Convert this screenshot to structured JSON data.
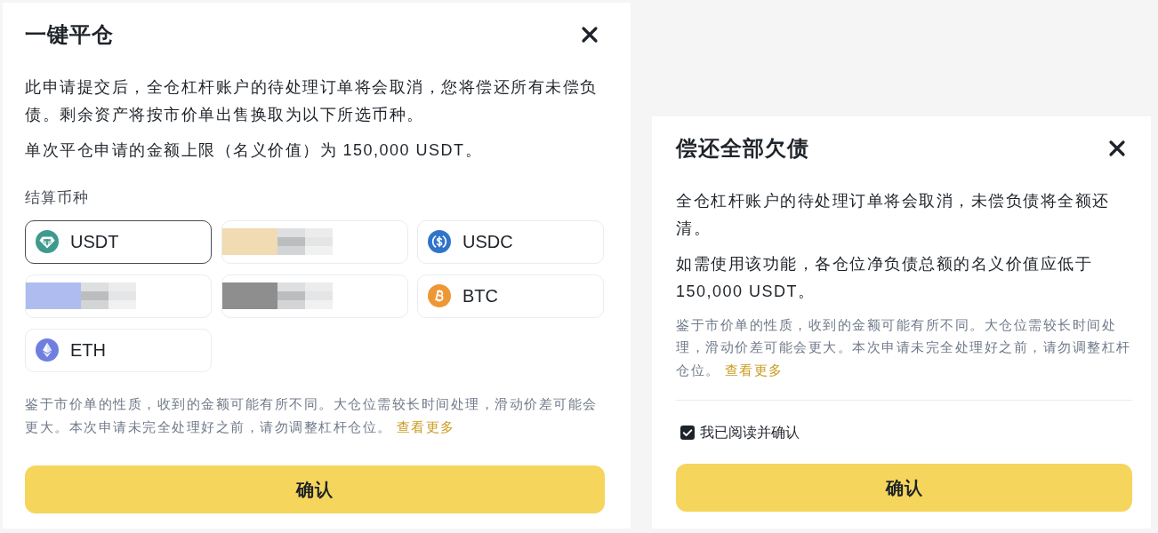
{
  "close_all_dialog": {
    "title": "一键平仓",
    "paragraphs": [
      "此申请提交后，全仓杠杆账户的待处理订单将会取消，您将偿还所有未偿负债。剩余资产将按市价单出售换取为以下所选币种。",
      "单次平仓申请的金额上限（名义价值）为 150,000 USDT。"
    ],
    "settlement": {
      "label": "结算币种",
      "options": [
        {
          "kind": "usdt",
          "label": "USDT",
          "selected": true
        },
        {
          "kind": "redacted",
          "selected": false,
          "color": "#f0dbb2"
        },
        {
          "kind": "usdc",
          "label": "USDC",
          "selected": false
        },
        {
          "kind": "redacted",
          "selected": false,
          "color": "#aebcef"
        },
        {
          "kind": "redacted",
          "selected": false,
          "color": "#8e8e8e"
        },
        {
          "kind": "btc",
          "label": "BTC",
          "selected": false
        },
        {
          "kind": "eth",
          "label": "ETH",
          "selected": false
        }
      ]
    },
    "notice": {
      "text": "鉴于市价单的性质，收到的金额可能有所不同。大仓位需较长时间处理，滑动价差可能会更大。本次申请未完全处理好之前，请勿调整杠杆仓位。",
      "link": "查看更多"
    },
    "confirm_button": "确认"
  },
  "repay_all_dialog": {
    "title": "偿还全部欠债",
    "paragraphs": [
      "全仓杠杆账户的待处理订单将会取消，未偿负债将全额还清。",
      "如需使用该功能，各仓位净负债总额的名义价值应低于 150,000 USDT。"
    ],
    "notice": {
      "text": "鉴于市价单的性质，收到的金额可能有所不同。大仓位需较长时间处理，滑动价差可能会更大。本次申请未完全处理好之前，请勿调整杠杆仓位。",
      "link": "查看更多"
    },
    "acknowledge": {
      "label": "我已阅读并确认",
      "checked": true
    },
    "confirm_button": "确认"
  }
}
